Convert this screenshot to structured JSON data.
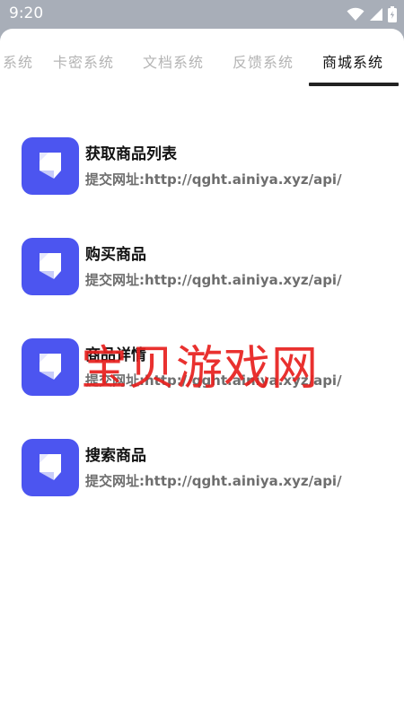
{
  "status_bar": {
    "time": "9:20"
  },
  "tabs": [
    {
      "label": "系统",
      "active": false
    },
    {
      "label": "卡密系统",
      "active": false
    },
    {
      "label": "文档系统",
      "active": false
    },
    {
      "label": "反馈系统",
      "active": false
    },
    {
      "label": "商城系统",
      "active": true
    }
  ],
  "items": [
    {
      "title": "获取商品列表",
      "subtitle": "提交网址:http://qght.ainiya.xyz/api/"
    },
    {
      "title": "购买商品",
      "subtitle": "提交网址:http://qght.ainiya.xyz/api/"
    },
    {
      "title": "商品详情",
      "subtitle": "提交网址:http://qght.ainiya.xyz/api/"
    },
    {
      "title": "搜索商品",
      "subtitle": "提交网址:http://qght.ainiya.xyz/api/"
    }
  ],
  "watermark": "宝贝游戏网",
  "colors": {
    "accent": "#4c55f0",
    "watermark": "#e8201e"
  },
  "icons": {
    "item_icon": "folded-corner-document-icon",
    "wifi": "wifi-icon",
    "signal": "cell-signal-icon",
    "battery": "battery-icon"
  }
}
